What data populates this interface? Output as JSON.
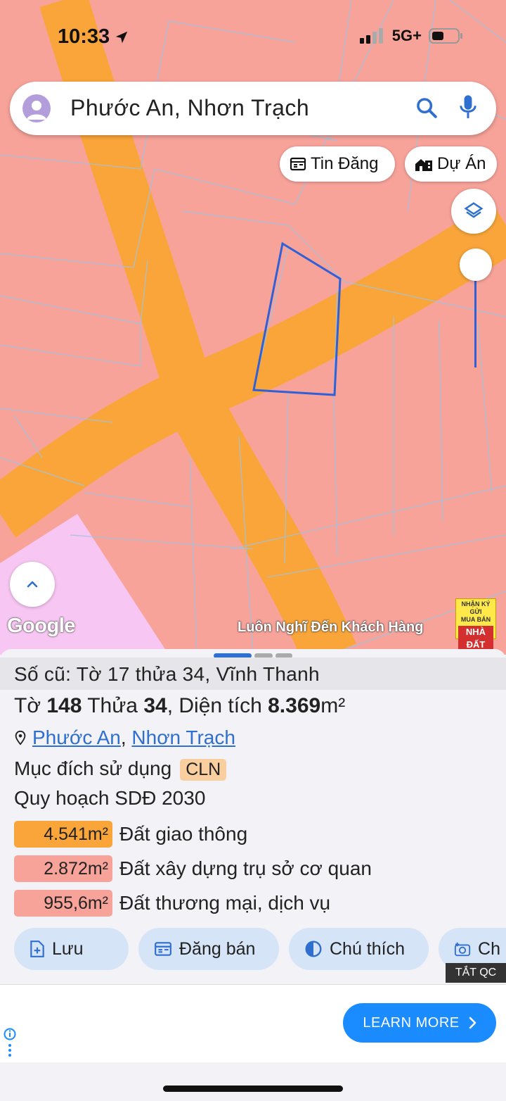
{
  "status_bar": {
    "time": "10:33",
    "network": "5G+"
  },
  "search": {
    "query": "Phước An, Nhơn Trạch"
  },
  "chips": {
    "listings": "Tin Đăng",
    "projects": "Dự Án"
  },
  "map": {
    "watermark": "Google",
    "slogan": "Luôn Nghĩ Đến Khách Hàng",
    "badge_line1": "NHẬN KÝ GỬI",
    "badge_line2": "MUA BÁN",
    "badge_line3": "NHÀ ĐẤT"
  },
  "parcel": {
    "old_info": "Số cũ: Tờ 17 thửa 34, Vĩnh Thanh",
    "sheet_label": "Tờ",
    "sheet_no": "148",
    "plot_label": "Thửa",
    "plot_no": "34",
    "area_label": "Diện tích",
    "area_value": "8.369",
    "area_unit": "m²",
    "commune": "Phước An",
    "district": "Nhơn Trạch",
    "usage_label": "Mục đích sử dụng",
    "usage_code": "CLN",
    "plan_label": "Quy hoạch SDĐ 2030",
    "zones": [
      {
        "area": "4.541m²",
        "label": "Đất giao thông",
        "color": "#f9a53a"
      },
      {
        "area": "2.872m²",
        "label": "Đất xây dựng trụ sở cơ quan",
        "color": "#f7a39a"
      },
      {
        "area": "955,6m²",
        "label": "Đất thương mại, dịch vụ",
        "color": "#f7a39a"
      }
    ]
  },
  "actions": {
    "save": "Lưu",
    "post": "Đăng bán",
    "legend": "Chú thích",
    "capture": "Ch"
  },
  "ad": {
    "hide": "TẮT QC",
    "cta": "LEARN MORE"
  }
}
